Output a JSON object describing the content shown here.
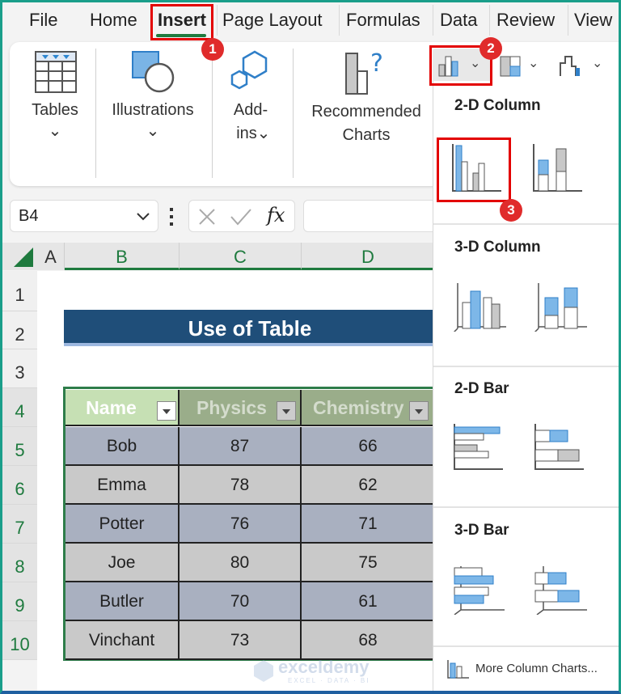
{
  "tabs": [
    {
      "label": "File"
    },
    {
      "label": "Home"
    },
    {
      "label": "Insert",
      "active": true
    },
    {
      "label": "Page Layout"
    },
    {
      "label": "Formulas"
    },
    {
      "label": "Data"
    },
    {
      "label": "Review"
    },
    {
      "label": "View"
    }
  ],
  "ribbon": {
    "tables": "Tables",
    "illustrations": "Illustrations",
    "addins_1": "Add-",
    "addins_2": "ins",
    "recommended_1": "Recommended",
    "recommended_2": "Charts",
    "chevron": "⌄"
  },
  "formula_bar": {
    "name_box": "B4",
    "fx": "fx",
    "value": ""
  },
  "columns": [
    "A",
    "B",
    "C",
    "D"
  ],
  "rows": [
    "1",
    "2",
    "3",
    "4",
    "5",
    "6",
    "7",
    "8",
    "9",
    "10"
  ],
  "sheet": {
    "title": "Use of Table",
    "headers": [
      "Name",
      "Physics",
      "Chemistry"
    ],
    "data": [
      [
        "Bob",
        "87",
        "66"
      ],
      [
        "Emma",
        "78",
        "62"
      ],
      [
        "Potter",
        "76",
        "71"
      ],
      [
        "Joe",
        "80",
        "75"
      ],
      [
        "Butler",
        "70",
        "61"
      ],
      [
        "Vinchant",
        "73",
        "68"
      ]
    ]
  },
  "gallery": {
    "sections": [
      "2-D Column",
      "3-D Column",
      "2-D Bar",
      "3-D Bar"
    ],
    "more": "More Column Charts..."
  },
  "steps": [
    "1",
    "2",
    "3"
  ],
  "watermark": {
    "name": "exceldemy",
    "tagline": "EXCEL · DATA · BI"
  },
  "colors": {
    "accent_green": "#1e7a3e",
    "title_fill": "#1f4e79",
    "header_name": "#c6e0b4",
    "header_other": "#9aad8a",
    "row_odd": "#a9b0c0",
    "row_even": "#c9c9c9",
    "highlight": "#e30000",
    "chart_blue": "#7db7e8"
  }
}
